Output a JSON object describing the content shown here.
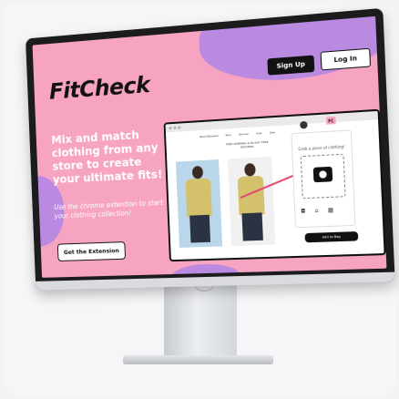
{
  "brand": {
    "name": "FitCheck",
    "accent": "#f7a4c2",
    "secondary": "#b98ae0"
  },
  "header": {
    "signup_label": "Sign Up",
    "login_label": "Log In"
  },
  "hero": {
    "headline": "Mix and match clothing from any store to create your ultimate fits!",
    "subtext": "Use the chrome extention to start your clothing collection!",
    "cta_label": "Get the Extension"
  },
  "extension_panel": {
    "badge": "FC",
    "prompt": "Grab a piece of clothing!",
    "icons": [
      "camera-icon",
      "hanger-icon",
      "grid-icon"
    ],
    "add_to_bag": "Add to Bag"
  },
  "store": {
    "nav_items": [
      "New Releases",
      "Men",
      "Women",
      "Kids",
      "Sale"
    ],
    "promo": "FREE SHIPPING & 60-DAY FREE RETURNS"
  }
}
